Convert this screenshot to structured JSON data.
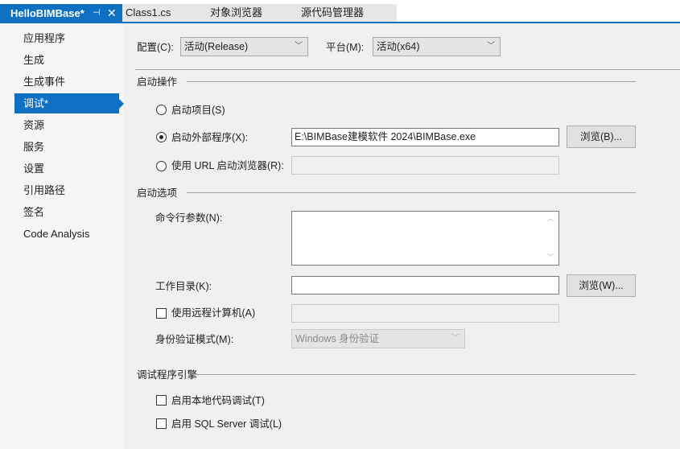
{
  "tabs": {
    "active": "HelloBIMBase*",
    "pin": "⊣",
    "close": "✕",
    "others": [
      "Class1.cs",
      "对象浏览器",
      "源代码管理器"
    ]
  },
  "sidebar": {
    "items": [
      "应用程序",
      "生成",
      "生成事件",
      "调试*",
      "资源",
      "服务",
      "设置",
      "引用路径",
      "签名",
      "Code Analysis"
    ],
    "selected": 3
  },
  "config": {
    "label": "配置(C):",
    "value": "活动(Release)",
    "platform_label": "平台(M):",
    "platform_value": "活动(x64)"
  },
  "start_action": {
    "title": "启动操作",
    "project": "启动项目(S)",
    "external": "启动外部程序(X):",
    "external_value": "E:\\BIMBase建模软件 2024\\BIMBase.exe",
    "browse_b": "浏览(B)...",
    "url": "使用 URL 启动浏览器(R):",
    "url_value": ""
  },
  "start_options": {
    "title": "启动选项",
    "args_label": "命令行参数(N):",
    "args_value": "",
    "workdir_label": "工作目录(K):",
    "workdir_value": "",
    "browse_w": "浏览(W)...",
    "remote": "使用远程计算机(A)",
    "remote_value": "",
    "auth_label": "身份验证模式(M):",
    "auth_value": "Windows 身份验证"
  },
  "engines": {
    "title": "调试程序引擎",
    "native": "启用本地代码调试(T)",
    "sql": "启用 SQL Server 调试(L)"
  }
}
